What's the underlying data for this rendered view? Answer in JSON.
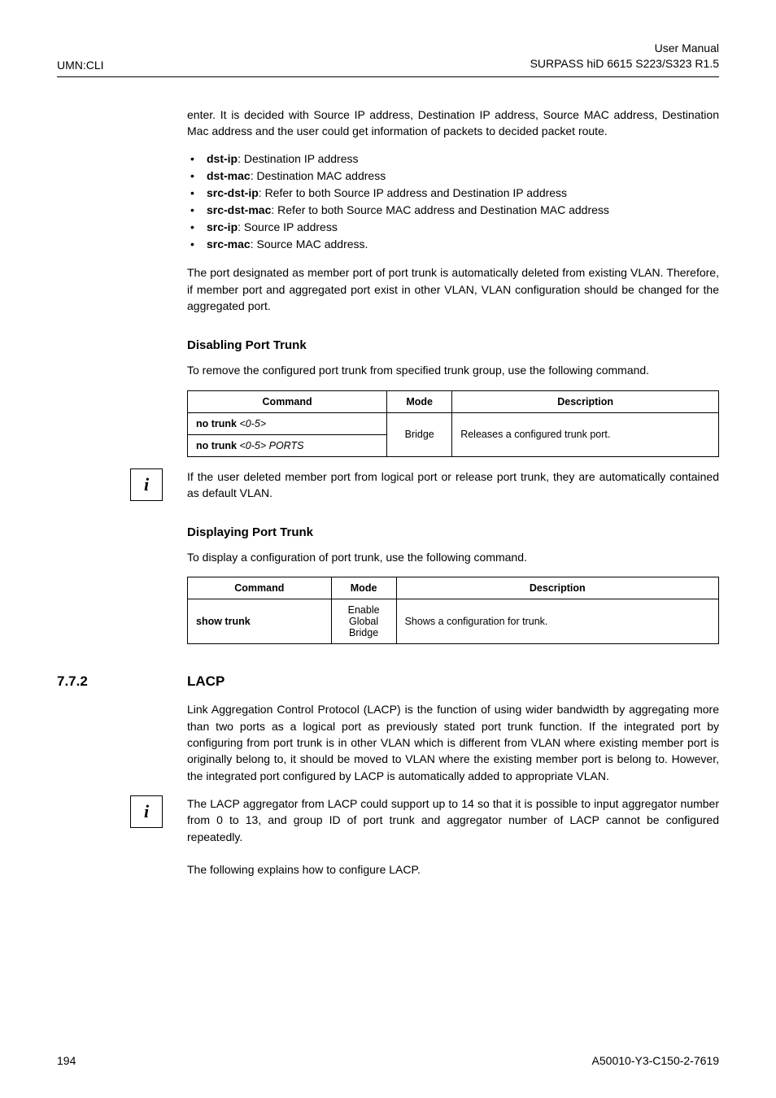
{
  "header": {
    "left": "UMN:CLI",
    "right_line1": "User Manual",
    "right_line2": "SURPASS hiD 6615 S223/S323 R1.5"
  },
  "intro_para": "enter. It is decided with Source IP address, Destination IP address, Source MAC address, Destination Mac address and the user could get information of packets to decided packet route.",
  "bullets": [
    {
      "bold": "dst-ip",
      "tail": ": Destination IP address"
    },
    {
      "bold": "dst-mac",
      "tail": ": Destination MAC address"
    },
    {
      "bold": "src-dst-ip",
      "tail": ": Refer to both Source IP address and Destination IP address"
    },
    {
      "bold": "src-dst-mac",
      "tail": ": Refer to both Source MAC address and Destination MAC address"
    },
    {
      "bold": "src-ip",
      "tail": ": Source IP address"
    },
    {
      "bold": "src-mac",
      "tail": ": Source MAC address."
    }
  ],
  "after_bullets_para": "The port designated as member port of port trunk is automatically deleted from existing VLAN. Therefore, if member port and aggregated port exist in other VLAN, VLAN configuration should be changed for the aggregated port.",
  "heading_disable": "Disabling Port Trunk",
  "disable_para": "To remove the configured port trunk from specified trunk group, use the following command.",
  "table1": {
    "headers": [
      "Command",
      "Mode",
      "Description"
    ],
    "row1_cmd_1": "no trunk ",
    "row1_cmd_2": "<0-5>",
    "row2_cmd_1": "no trunk ",
    "row2_cmd_2": "<0-5> ",
    "row2_cmd_3": "PORTS",
    "mode": "Bridge",
    "desc": "Releases a configured trunk port."
  },
  "note1": "If the user deleted member port from logical port or release port trunk, they are automatically contained as default VLAN.",
  "heading_display": "Displaying Port Trunk",
  "display_para": "To display a configuration of port trunk, use the following command.",
  "table2": {
    "headers": [
      "Command",
      "Mode",
      "Description"
    ],
    "cmd": "show trunk",
    "mode_line1": "Enable",
    "mode_line2": "Global",
    "mode_line3": "Bridge",
    "desc": "Shows a configuration for trunk."
  },
  "section": {
    "number": "7.7.2",
    "title": "LACP"
  },
  "lacp_para": "Link Aggregation Control Protocol (LACP) is the function of using wider bandwidth by aggregating more than two ports as a logical port as previously stated port trunk function. If the integrated port by configuring from port trunk is in other VLAN which is different from VLAN where existing member port is originally belong to, it should be moved to VLAN where the existing member port is belong to. However, the integrated port configured by LACP is automatically added to appropriate VLAN.",
  "note2": "The LACP aggregator from LACP could support up to 14 so that it is possible to input aggregator number from 0 to 13, and group ID of port trunk and aggregator number of LACP cannot be configured repeatedly.",
  "closing_para": "The following explains how to configure LACP.",
  "footer": {
    "page": "194",
    "code": "A50010-Y3-C150-2-7619"
  },
  "note_icon_glyph": "i"
}
